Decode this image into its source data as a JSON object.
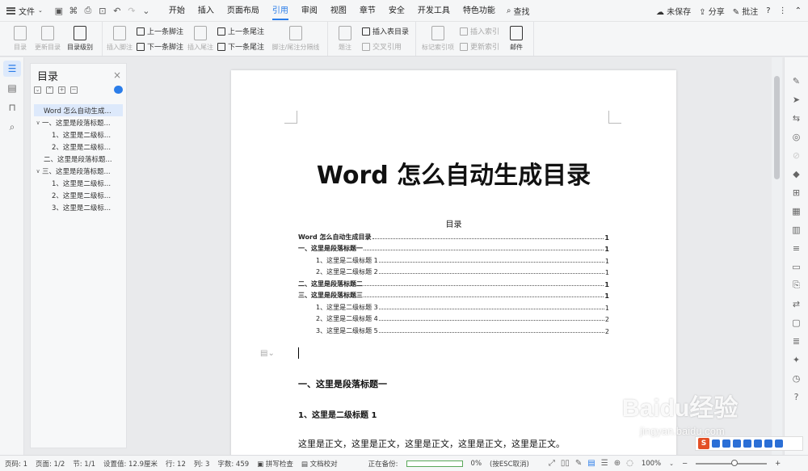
{
  "menubar": {
    "file_label": "文件",
    "menus": [
      "开始",
      "插入",
      "页面布局",
      "引用",
      "审阅",
      "视图",
      "章节",
      "安全",
      "开发工具",
      "特色功能"
    ],
    "active_menu_index": 3,
    "search_label": "查找",
    "unsaved": "未保存",
    "share": "分享",
    "comment": "批注",
    "help": "?"
  },
  "ribbon": {
    "toc_btn": "目录",
    "update_toc": "更新目录",
    "toc_level": "目录级别",
    "insert_footnote": "插入脚注",
    "prev_footnote": "上一条脚注",
    "next_footnote": "下一条脚注",
    "insert_endnote": "插入尾注",
    "prev_endnote": "上一条尾注",
    "next_endnote": "下一条尾注",
    "separator": "脚注/尾注分隔线",
    "caption": "题注",
    "insert_table_toc": "插入表目录",
    "cross_ref": "交叉引用",
    "mark_index": "标记索引项",
    "insert_index": "插入索引",
    "update_index": "更新索引",
    "mail": "邮件"
  },
  "toc_panel": {
    "title": "目录",
    "close": "×",
    "items": [
      {
        "arrow": "",
        "text": "Word 怎么自动生成...",
        "indent": 16,
        "selected": true
      },
      {
        "arrow": "∨",
        "text": "一、这里是段落标题...",
        "indent": 4,
        "selected": false
      },
      {
        "arrow": "",
        "text": "1、这里是二级标...",
        "indent": 26,
        "selected": false
      },
      {
        "arrow": "",
        "text": "2、这里是二级标...",
        "indent": 26,
        "selected": false
      },
      {
        "arrow": "",
        "text": "二、这里是段落标题...",
        "indent": 16,
        "selected": false
      },
      {
        "arrow": "∨",
        "text": "三、这里是段落标题...",
        "indent": 4,
        "selected": false
      },
      {
        "arrow": "",
        "text": "1、这里是二级标...",
        "indent": 26,
        "selected": false
      },
      {
        "arrow": "",
        "text": "2、这里是二级标...",
        "indent": 26,
        "selected": false
      },
      {
        "arrow": "",
        "text": "3、这里是二级标...",
        "indent": 26,
        "selected": false
      }
    ]
  },
  "document": {
    "title": "Word 怎么自动生成目录",
    "toc_heading": "目录",
    "toc_lines": [
      {
        "level": 1,
        "text": "Word 怎么自动生成目录",
        "page": "1"
      },
      {
        "level": 1,
        "text": "一、这里是段落标题一",
        "page": "1"
      },
      {
        "level": 2,
        "text": "1、这里是二级标题 1",
        "page": "1"
      },
      {
        "level": 2,
        "text": "2、这里是二级标题 2",
        "page": "1"
      },
      {
        "level": 1,
        "text": "二、这里是段落标题二",
        "page": "1"
      },
      {
        "level": 1,
        "text": "三、这里是段落标题三",
        "page": "1"
      },
      {
        "level": 2,
        "text": "1、这里是二级标题 3",
        "page": "1"
      },
      {
        "level": 2,
        "text": "2、这里是二级标题 4",
        "page": "2"
      },
      {
        "level": 2,
        "text": "3、这里是二级标题 5",
        "page": "2"
      }
    ],
    "heading1": "一、这里是段落标题一",
    "heading2": "1、这里是二级标题 1",
    "body": "这里是正文，这里是正文，这里是正文，这里是正文，这里是正文。"
  },
  "status": {
    "page_code": "页码: 1",
    "page": "页面: 1/2",
    "section": "节: 1/1",
    "setting": "设置值: 12.9厘米",
    "row": "行: 12",
    "col": "列: 3",
    "words": "字数: 459",
    "spell": "拼写检查",
    "proof": "文档校对",
    "backup": "正在备份:",
    "percent": "0%",
    "cancel": "(按ESC取消)",
    "backup_progress": 0,
    "zoom": "100%"
  },
  "watermark": {
    "brand": "Baidu经验",
    "site": "jingyan.baidu.com"
  },
  "colors": {
    "accent": "#2b7de9",
    "progress": "#5aa85a"
  }
}
